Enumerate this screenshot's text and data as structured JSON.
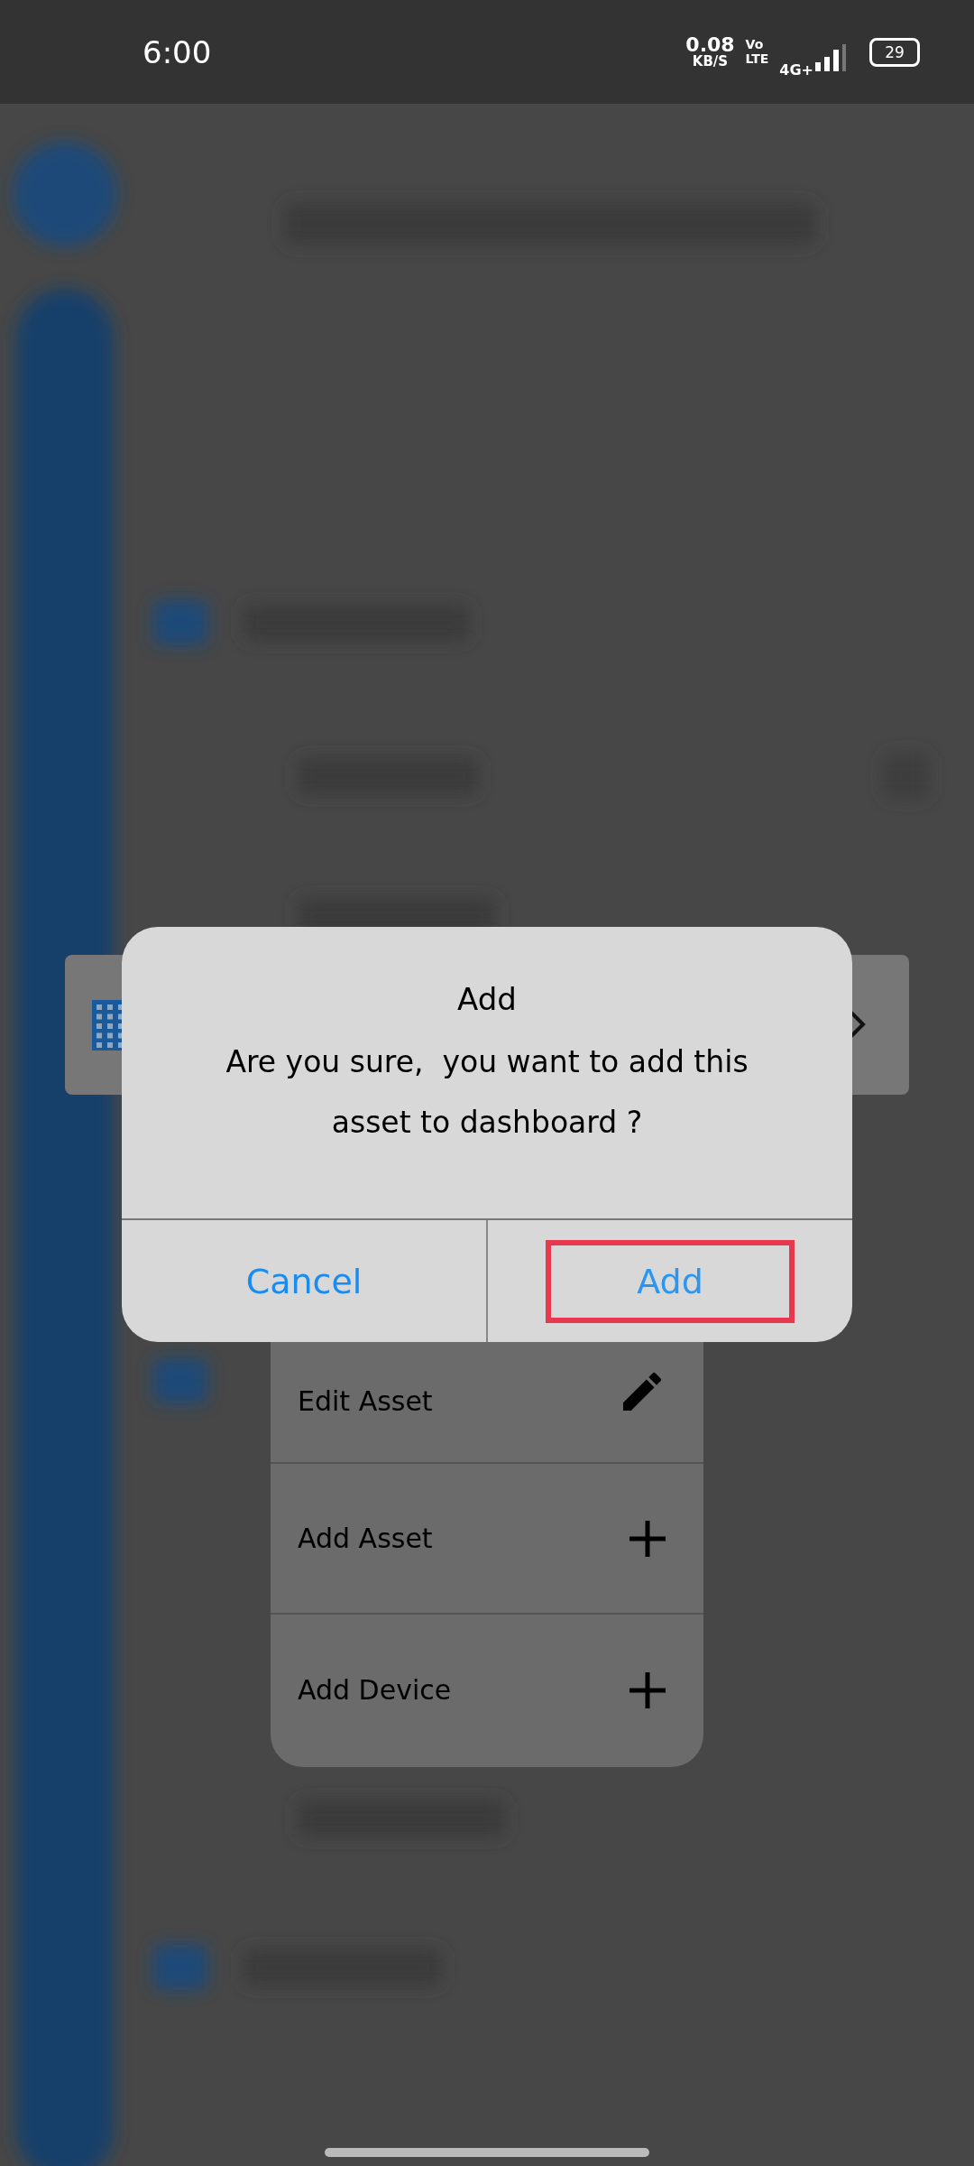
{
  "status_bar": {
    "time": "6:00",
    "net_speed": "0.08",
    "net_unit": "KB/S",
    "volte_top": "Vo",
    "volte_bottom": "LTE",
    "network": "4G+",
    "battery": "29"
  },
  "dialog": {
    "title": "Add",
    "message": "Are you sure,  you want to add this asset to dashboard ?",
    "buttons": [
      {
        "label": "Cancel",
        "selected": false
      },
      {
        "label": "Add",
        "selected": true
      }
    ]
  },
  "menu": {
    "items": [
      {
        "label": "Edit Asset",
        "kind": "pencil"
      },
      {
        "label": "Add Asset",
        "kind": "plus"
      },
      {
        "label": "Add Device",
        "kind": "plus"
      }
    ]
  }
}
